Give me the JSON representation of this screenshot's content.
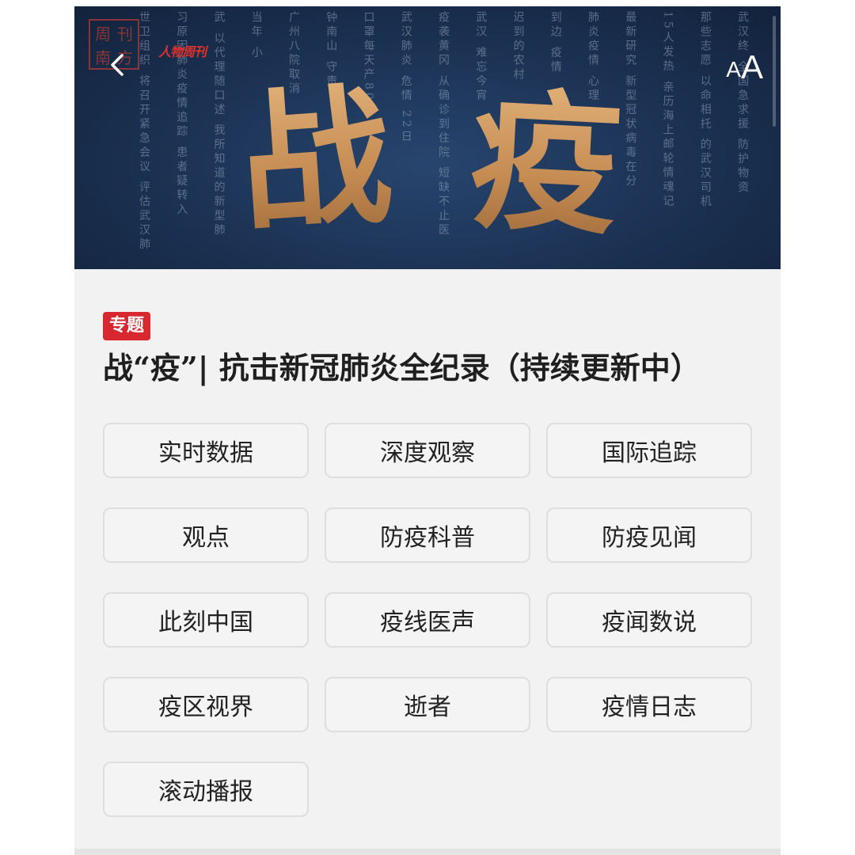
{
  "hero": {
    "title_chars": [
      "战",
      "疫"
    ],
    "background_columns": [
      "武汉终 全国急求援 防护物资",
      "那些志愿 以命相托 的武汉司机",
      "15人发热 亲历海上邮轮情魂记",
      "最新研究 新型冠状病毒在分",
      "肺炎疫情 心理",
      "到边 疫情",
      "迟到的农村 ",
      "武汉 难忘今宵",
      "疫袭黄冈 从确诊到住院 短缺不止医",
      "武汉肺炎 危情 22日",
      "口罩每天产80",
      "钟南山 守责",
      "广州八院取消",
      "当年 小",
      "武 以代理随口述 我所知道的新型肺",
      "习原因肺炎疫情追踪 患者疑转入",
      "世卫组织 将召开紧急会议 评估武汉肺"
    ],
    "seal_text": [
      "周",
      "刊",
      "南",
      "方"
    ],
    "brand_logo": "人物周刊",
    "back_icon": "chevron-left-icon",
    "font_size_label_small": "A",
    "font_size_label_big": "A",
    "title_color": "#c8935c"
  },
  "article": {
    "tag": "专题",
    "tag_color": "#d7272f",
    "headline": "战“疫”| 抗击新冠肺炎全纪录（持续更新中）"
  },
  "categories": [
    {
      "label": "实时数据"
    },
    {
      "label": "深度观察"
    },
    {
      "label": "国际追踪"
    },
    {
      "label": "观点"
    },
    {
      "label": "防疫科普"
    },
    {
      "label": "防疫见闻"
    },
    {
      "label": "此刻中国"
    },
    {
      "label": "疫线医声"
    },
    {
      "label": "疫闻数说"
    },
    {
      "label": "疫区视界"
    },
    {
      "label": "逝者"
    },
    {
      "label": "疫情日志"
    },
    {
      "label": "滚动播报"
    }
  ]
}
